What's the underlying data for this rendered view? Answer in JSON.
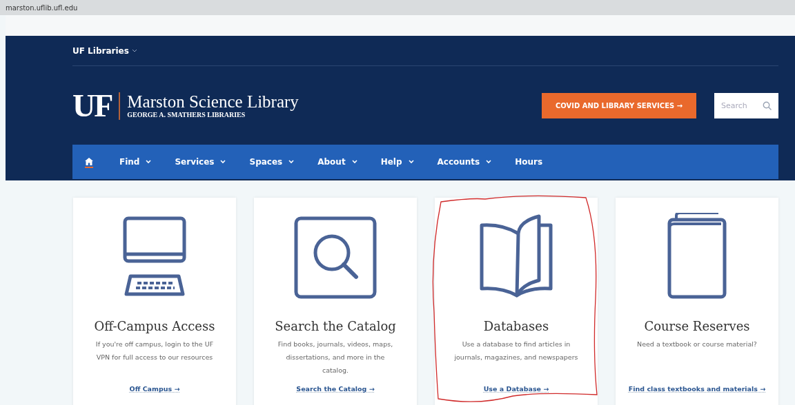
{
  "address_bar": {
    "url": "marston.uflib.ufl.edu"
  },
  "header": {
    "libraries_menu": "UF Libraries",
    "logo": {
      "mark": "UF",
      "title": "Marston Science Library",
      "subtitle": "GEORGE A. SMATHERS LIBRARIES"
    },
    "covid_button": "COVID AND LIBRARY SERVICES →",
    "search": {
      "placeholder": "Search"
    }
  },
  "nav": [
    {
      "kind": "home",
      "selected": true
    },
    {
      "kind": "menu",
      "label": "Find",
      "selected": false
    },
    {
      "kind": "menu",
      "label": "Services",
      "selected": false
    },
    {
      "kind": "menu",
      "label": "Spaces",
      "selected": false
    },
    {
      "kind": "menu",
      "label": "About",
      "selected": false
    },
    {
      "kind": "menu",
      "label": "Help",
      "selected": false
    },
    {
      "kind": "menu",
      "label": "Accounts",
      "selected": false
    },
    {
      "kind": "link",
      "label": "Hours",
      "selected": false
    }
  ],
  "cards": [
    {
      "kind": "computer",
      "title": "Off-Campus Access",
      "text": "If you're off campus, login to the UF VPN for full access to our resources",
      "link": "Off Campus →",
      "circled": false
    },
    {
      "kind": "search",
      "title": "Search the Catalog",
      "text": "Find books, journals, videos, maps, dissertations, and more in the catalog.",
      "link": "Search the Catalog →",
      "circled": false
    },
    {
      "kind": "open-book",
      "title": "Databases",
      "text": "Use a database to find articles in journals, magazines, and newspapers",
      "link": "Use a Database →",
      "circled": true
    },
    {
      "kind": "book",
      "title": "Course Reserves",
      "text": "Need a textbook or course material?",
      "link": "Find class textbooks and materials →",
      "circled": false
    }
  ]
}
